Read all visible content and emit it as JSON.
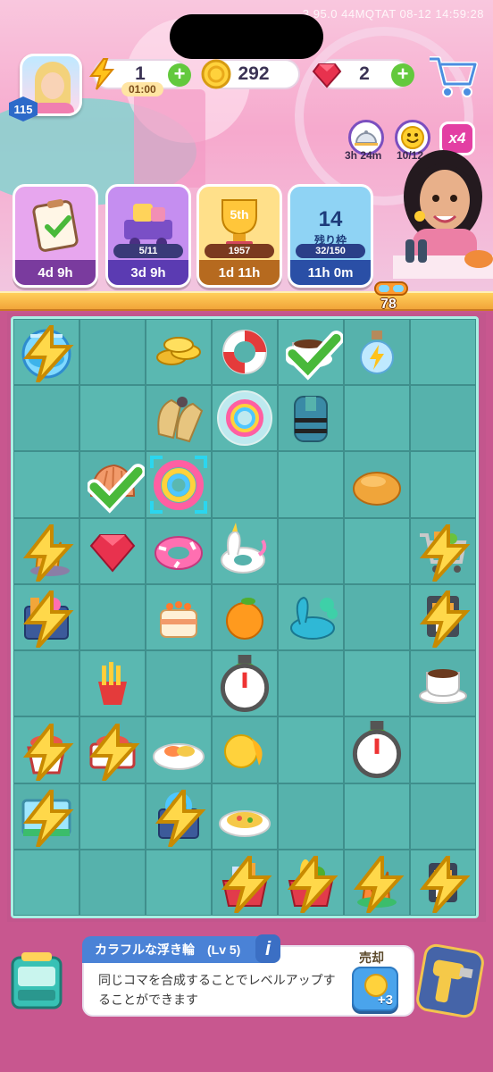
{
  "status_bar": {
    "text": "3.95.0  44MQTAT  08-12  14:59:28"
  },
  "player": {
    "level": "115"
  },
  "resources": {
    "energy": {
      "value": "1",
      "timer": "01:00"
    },
    "coins": {
      "value": "292"
    },
    "gems": {
      "value": "2"
    }
  },
  "bubbles": [
    {
      "icon": "cloche-icon",
      "label": "3h 24m"
    },
    {
      "icon": "smiley-icon",
      "label": "10/12"
    }
  ],
  "multiplier": {
    "label": "x4"
  },
  "event_cards": [
    {
      "icon": "clipboard-check-icon",
      "progress": "",
      "timer": "4d 9h"
    },
    {
      "icon": "cart-of-goods-icon",
      "progress": "5/11",
      "timer": "3d 9h"
    },
    {
      "icon": "trophy-icon",
      "rank": "5th",
      "progress": "1957",
      "timer": "1d 11h"
    },
    {
      "icon": "sea-puzzle-icon",
      "count": "14",
      "count_sub": "残り枠",
      "progress": "32/150",
      "timer": "11h 0m"
    }
  ],
  "diver_counter": {
    "value": "78"
  },
  "board": {
    "cols": 7,
    "rows": 9,
    "cells": [
      [
        "fishbowl",
        "",
        "coins",
        "life-ring",
        "coffee-cup-done",
        "energy-potion",
        ""
      ],
      [
        "",
        "",
        "swim-fins",
        "rainbow-ring-bubble",
        "life-vest",
        "",
        ""
      ],
      [
        "",
        "seashell-done",
        "rainbow-ring-selected",
        "",
        "",
        "bread-roll",
        ""
      ],
      [
        "coral-generator",
        "ruby-gem",
        "pink-float-ring",
        "unicorn-float",
        "",
        "",
        "shopping-cart-generator"
      ],
      [
        "toy-crate-generator",
        "",
        "cake",
        "orange",
        "peacock-float",
        "",
        "coffee-machine-generator"
      ],
      [
        "",
        "fries",
        "",
        "orange-tree-timer",
        "",
        "",
        "coffee-cup"
      ],
      [
        "fish-bucket-generator",
        "fish-tray-generator",
        "seafood-plate",
        "lemon-slice",
        "",
        "orange-tree-timer-2",
        ""
      ],
      [
        "aquarium-generator",
        "",
        "donut-ring-crate",
        "paella-plate",
        "",
        "",
        ""
      ],
      [
        "",
        "",
        "",
        "grocery-basket",
        "veggie-basket",
        "coral-cluster",
        "coffee-grinder"
      ]
    ]
  },
  "selected_item": {
    "title": "カラフルな浮き輪　(Lv 5)",
    "description": "同じコマを合成することでレベルアップすることができます",
    "sell_label": "売却",
    "sell_amount": "+3"
  },
  "colors": {
    "accent_pink": "#c8578f",
    "board_teal": "#56b2ac",
    "plus_green": "#63c93d",
    "selection_cyan": "#2bd6ef"
  }
}
